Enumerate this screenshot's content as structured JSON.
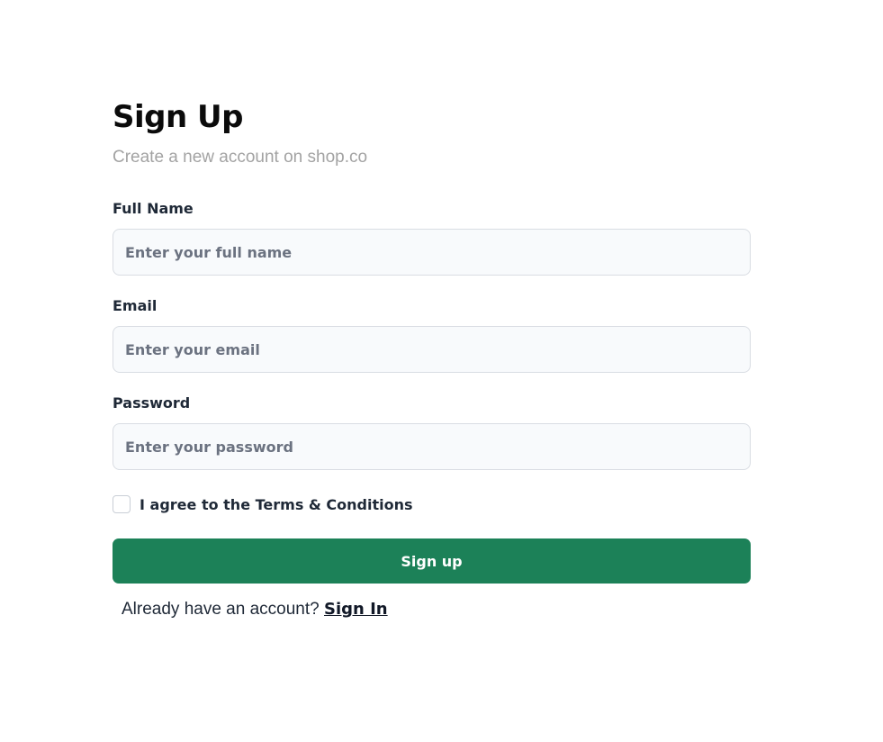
{
  "header": {
    "title": "Sign Up",
    "subtitle": "Create a new account on shop.co"
  },
  "fields": {
    "full_name": {
      "label": "Full Name",
      "value": "",
      "placeholder": "Enter your full name"
    },
    "email": {
      "label": "Email",
      "value": "",
      "placeholder": "Enter your email"
    },
    "password": {
      "label": "Password",
      "value": "",
      "placeholder": "Enter your password"
    }
  },
  "terms": {
    "label": "I agree to the Terms & Conditions",
    "checked": false
  },
  "submit": {
    "label": "Sign up"
  },
  "footer": {
    "prompt": "Already have an account?",
    "link_label": "Sign In"
  },
  "colors": {
    "primary": "#1c8158",
    "input_background": "#f8fafc",
    "input_border": "#d9dde3",
    "subtitle": "#a3a3a3"
  }
}
